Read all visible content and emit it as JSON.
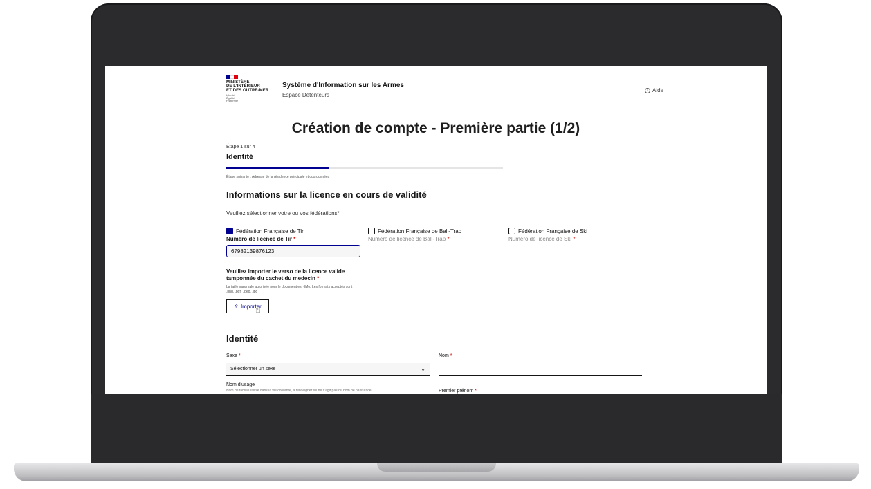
{
  "header": {
    "logo_text": [
      "MINISTÈRE",
      "DE L'INTÉRIEUR",
      "ET DES OUTRE-MER"
    ],
    "logo_motto": [
      "Liberté",
      "Égalité",
      "Fraternité"
    ],
    "site_title": "Système d'Information sur les Armes",
    "site_subtitle": "Espace Détenteurs",
    "help_label": "Aide",
    "flag_colors": [
      "#000091",
      "#ffffff",
      "#e1000f"
    ]
  },
  "page_title": "Création de compte - Première partie (1/2)",
  "stepper": {
    "count": "Étape 1 sur 4",
    "title": "Identité",
    "next": "Étape suivante : Adresse de la résidence principale et coordonnées",
    "progress": 0.25,
    "color": "#000091"
  },
  "licence": {
    "section_title": "Informations sur la licence en cours de validité",
    "federations_prompt": "Veuillez sélectionner votre ou vos fédérations",
    "federations": [
      {
        "label": "Fédération Française de Tir",
        "checked": true,
        "licence_label": "Numéro de licence de Tir"
      },
      {
        "label": "Fédération Française de Ball-Trap",
        "checked": false,
        "licence_label": "Numéro de licence de Ball-Trap"
      },
      {
        "label": "Fédération Française de Ski",
        "checked": false,
        "licence_label": "Numéro de licence de Ski"
      }
    ],
    "licence_value": "67982139876123",
    "upload_label": "Veuillez importer le verso de la licence valide tamponnée du cachet du medecin",
    "upload_hint": "La taille maximale autorisée pour le document est 6Mo. Les formats acceptés sont .png, .pdf, .jpeg, .jpg",
    "upload_button": "Importer"
  },
  "identity": {
    "section_title": "Identité",
    "sexe_label": "Sexe",
    "sexe_placeholder": "Sélectionner un sexe",
    "nom_label": "Nom",
    "usage_label": "Nom d'usage",
    "usage_hint": "Nom de famille utilisé dans la vie courante, à renseigner s'il ne s'agit pas du nom de naissance",
    "prenom_label": "Premier prénom",
    "required_mark": "*"
  }
}
